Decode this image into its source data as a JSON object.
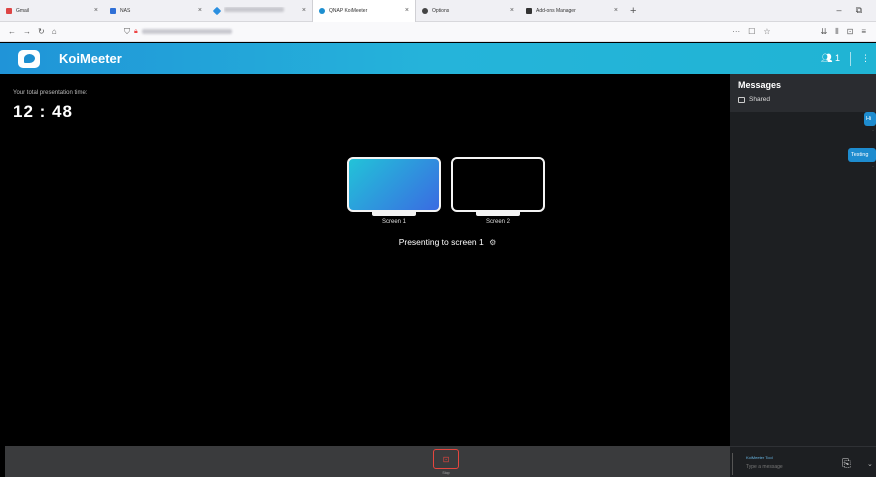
{
  "browser": {
    "tabs": [
      {
        "title": "Gmail",
        "favicon_color": "#d44",
        "active": false
      },
      {
        "title": "NAS",
        "favicon_color": "#2f6fd6",
        "active": false
      },
      {
        "title": "",
        "favicon_color": "#2a8fe0",
        "active": false
      },
      {
        "title": "QNAP KoiMeeter",
        "favicon_color": "#1d8fd0",
        "active": true
      },
      {
        "title": "Options",
        "favicon_color": "#444",
        "active": false
      },
      {
        "title": "Add-ons Manager",
        "favicon_color": "#333",
        "active": false
      }
    ],
    "tab_close_glyph": "×",
    "new_tab_glyph": "+",
    "window_controls": [
      "–",
      "⧉"
    ],
    "url_right_icons": [
      "···",
      "☐",
      "☆"
    ],
    "browser_icons": [
      "⇊",
      "⫴",
      "⊡",
      "≡"
    ]
  },
  "app": {
    "name": "KoiMeeter",
    "participants_count": "1",
    "accent": "#25b4da"
  },
  "stage": {
    "presentation_time_label": "Your total presentation time:",
    "presentation_time": "12 : 48",
    "screens": [
      {
        "label": "Screen 1",
        "selected": true
      },
      {
        "label": "Screen 2",
        "selected": false
      }
    ],
    "presenting_text": "Presenting to screen 1",
    "settings_glyph": "⚙"
  },
  "messages": {
    "title": "Messages",
    "shared_label": "Shared",
    "bubbles": [
      "Hi",
      "Testing"
    ]
  },
  "bottombar": {
    "stop_label": "Stop"
  },
  "composer": {
    "sender": "KoiMeeter Tool",
    "placeholder": "Type a message"
  }
}
